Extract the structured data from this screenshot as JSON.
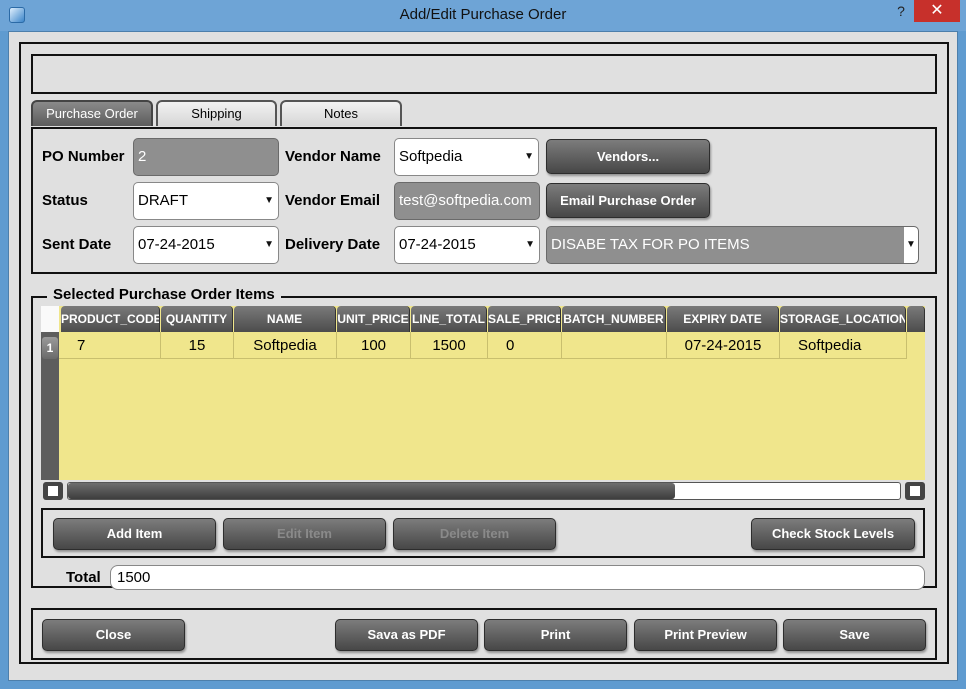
{
  "window": {
    "title": "Add/Edit Purchase Order",
    "help": "?",
    "close": "✕"
  },
  "tabs": [
    {
      "label": "Purchase Order",
      "active": true
    },
    {
      "label": "Shipping",
      "active": false
    },
    {
      "label": "Notes",
      "active": false
    }
  ],
  "form": {
    "po_number": {
      "label": "PO Number",
      "value": "2"
    },
    "vendor_name": {
      "label": "Vendor Name",
      "value": "Softpedia"
    },
    "vendors_button": "Vendors...",
    "status": {
      "label": "Status",
      "value": "DRAFT"
    },
    "vendor_email": {
      "label": "Vendor Email",
      "value": "test@softpedia.com"
    },
    "email_button": "Email Purchase Order",
    "sent_date": {
      "label": "Sent Date",
      "value": "07-24-2015"
    },
    "delivery_date": {
      "label": "Delivery Date",
      "value": "07-24-2015"
    },
    "tax_option": {
      "value": "DISABE TAX FOR PO ITEMS"
    }
  },
  "items": {
    "title": "Selected Purchase Order Items",
    "columns": [
      "PRODUCT_CODE",
      "QUANTITY",
      "NAME",
      "UNIT_PRICE",
      "LINE_TOTAL",
      "SALE_PRICE",
      "BATCH_NUMBER",
      "EXPIRY DATE",
      "STORAGE_LOCATION"
    ],
    "rows": [
      {
        "num": "1",
        "cells": [
          "7",
          "15",
          "Softpedia",
          "100",
          "1500",
          "0",
          "",
          "07-24-2015",
          "Softpedia"
        ]
      }
    ],
    "scroll_position": 0.73
  },
  "item_buttons": {
    "add": "Add Item",
    "edit": "Edit Item",
    "delete": "Delete Item",
    "check_stock": "Check Stock Levels"
  },
  "total": {
    "label": "Total",
    "value": "1500"
  },
  "footer": {
    "close": "Close",
    "save_pdf": "Sava as PDF",
    "print": "Print",
    "print_preview": "Print Preview",
    "save": "Save"
  }
}
